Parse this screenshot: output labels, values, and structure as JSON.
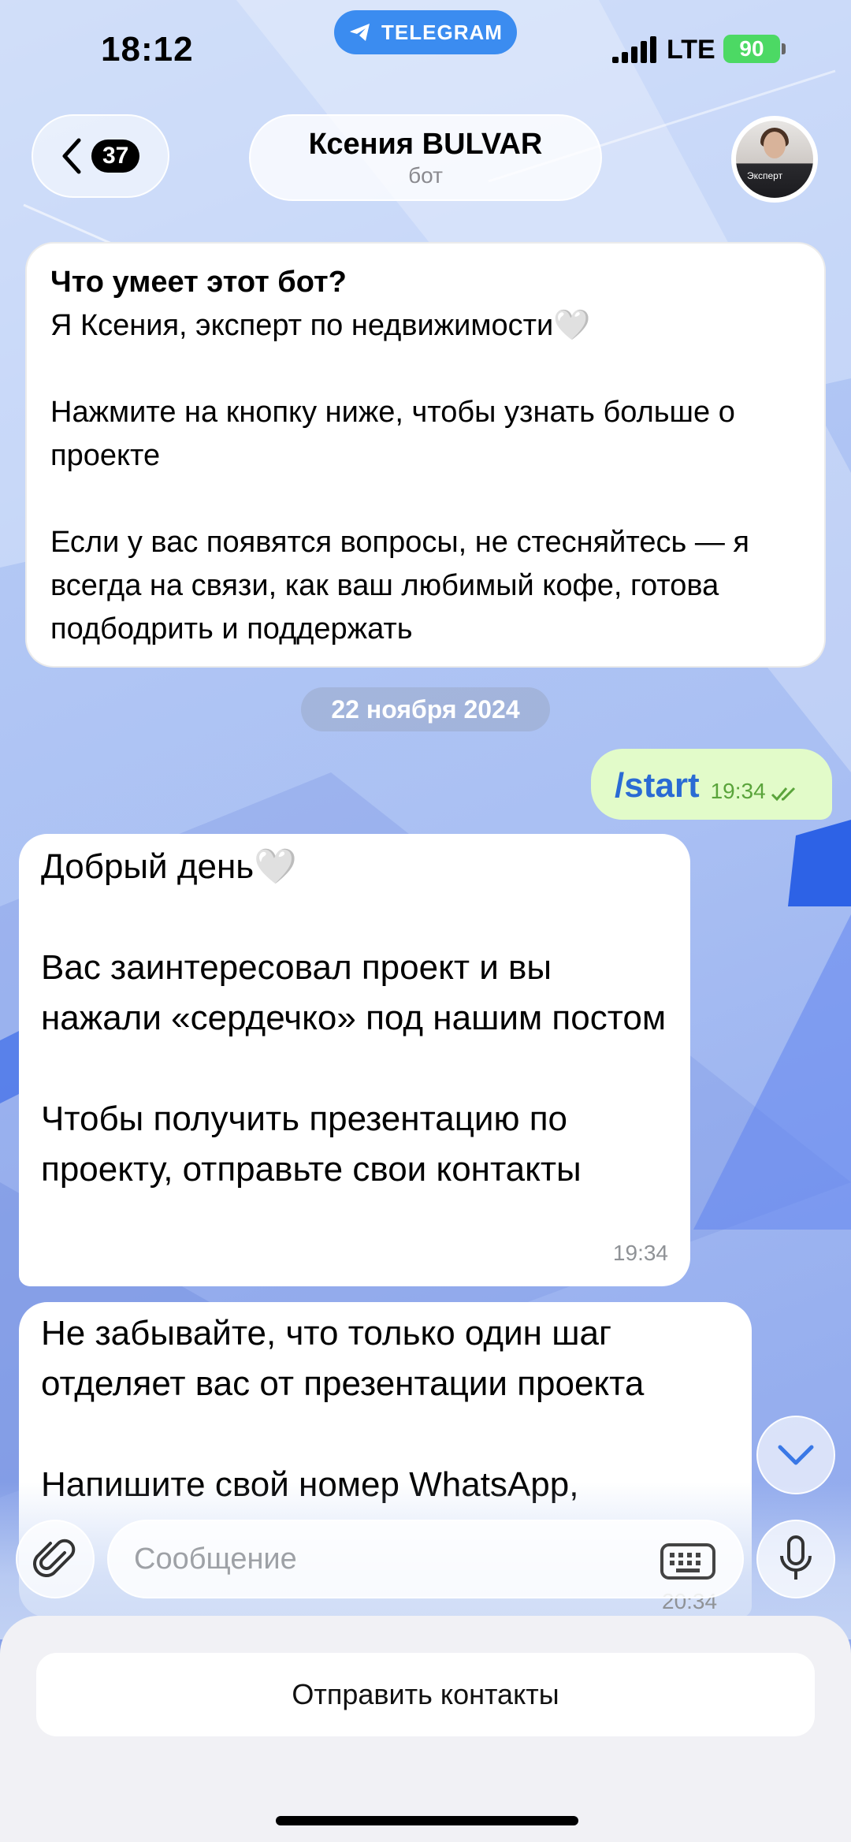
{
  "status_bar": {
    "time": "18:12",
    "app_pill": "TELEGRAM",
    "network": "LTE",
    "battery": "90"
  },
  "header": {
    "back_count": "37",
    "name": "Ксения BULVAR",
    "subtitle": "бот",
    "avatar_label": "Эксперт"
  },
  "messages": {
    "bot_info": {
      "title": "Что умеет этот бот?",
      "line1": "Я Ксения, эксперт по недвижимости🤍",
      "line2": "Нажмите на кнопку ниже, чтобы узнать больше о проекте",
      "line3": "Если у вас появятся вопросы, не стесняйтесь — я всегда на связи, как ваш любимый кофе, готова подбодрить и поддержать"
    },
    "date_separator": "22 ноября 2024",
    "outgoing": {
      "text": "/start",
      "time": "19:34"
    },
    "incoming1": {
      "p1": "Добрый день🤍",
      "p2": "Вас заинтересовал проект и вы нажали «сердечко» под нашим постом",
      "p3": "Чтобы получить презентацию по проекту, отправьте свои контакты",
      "time": "19:34"
    },
    "incoming2": {
      "p1": "Не забывайте, что только один шаг отделяет вас от презентации проекта",
      "p2": "Напишите свой номер WhatsApp,",
      "time": "20:34"
    }
  },
  "composer": {
    "placeholder": "Сообщение"
  },
  "keyboard_button": {
    "label": "Отправить контакты"
  },
  "colors": {
    "accent": "#3b8cf0",
    "outgoing_bubble": "#e2fbc9",
    "outgoing_meta": "#5aa43b",
    "command_link": "#2a6bd4",
    "battery": "#4cd964"
  }
}
